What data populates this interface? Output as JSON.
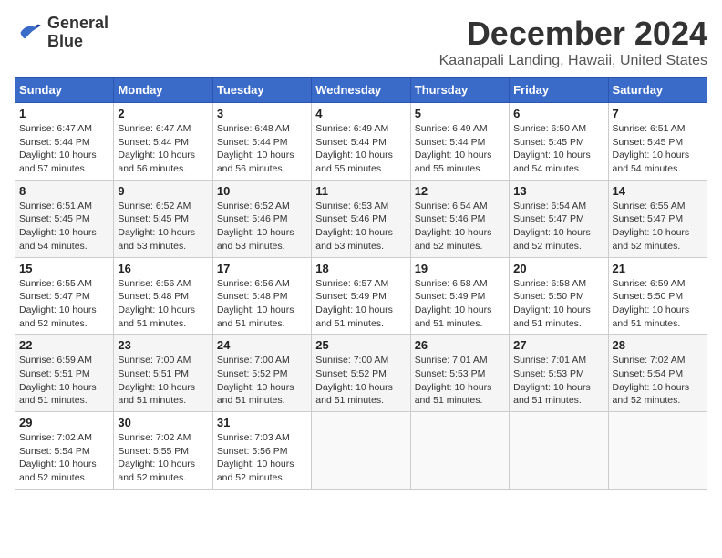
{
  "header": {
    "logo_line1": "General",
    "logo_line2": "Blue",
    "month": "December 2024",
    "location": "Kaanapali Landing, Hawaii, United States"
  },
  "weekdays": [
    "Sunday",
    "Monday",
    "Tuesday",
    "Wednesday",
    "Thursday",
    "Friday",
    "Saturday"
  ],
  "weeks": [
    [
      {
        "day": "1",
        "sunrise": "6:47 AM",
        "sunset": "5:44 PM",
        "daylight": "10 hours and 57 minutes."
      },
      {
        "day": "2",
        "sunrise": "6:47 AM",
        "sunset": "5:44 PM",
        "daylight": "10 hours and 56 minutes."
      },
      {
        "day": "3",
        "sunrise": "6:48 AM",
        "sunset": "5:44 PM",
        "daylight": "10 hours and 56 minutes."
      },
      {
        "day": "4",
        "sunrise": "6:49 AM",
        "sunset": "5:44 PM",
        "daylight": "10 hours and 55 minutes."
      },
      {
        "day": "5",
        "sunrise": "6:49 AM",
        "sunset": "5:44 PM",
        "daylight": "10 hours and 55 minutes."
      },
      {
        "day": "6",
        "sunrise": "6:50 AM",
        "sunset": "5:45 PM",
        "daylight": "10 hours and 54 minutes."
      },
      {
        "day": "7",
        "sunrise": "6:51 AM",
        "sunset": "5:45 PM",
        "daylight": "10 hours and 54 minutes."
      }
    ],
    [
      {
        "day": "8",
        "sunrise": "6:51 AM",
        "sunset": "5:45 PM",
        "daylight": "10 hours and 54 minutes."
      },
      {
        "day": "9",
        "sunrise": "6:52 AM",
        "sunset": "5:45 PM",
        "daylight": "10 hours and 53 minutes."
      },
      {
        "day": "10",
        "sunrise": "6:52 AM",
        "sunset": "5:46 PM",
        "daylight": "10 hours and 53 minutes."
      },
      {
        "day": "11",
        "sunrise": "6:53 AM",
        "sunset": "5:46 PM",
        "daylight": "10 hours and 53 minutes."
      },
      {
        "day": "12",
        "sunrise": "6:54 AM",
        "sunset": "5:46 PM",
        "daylight": "10 hours and 52 minutes."
      },
      {
        "day": "13",
        "sunrise": "6:54 AM",
        "sunset": "5:47 PM",
        "daylight": "10 hours and 52 minutes."
      },
      {
        "day": "14",
        "sunrise": "6:55 AM",
        "sunset": "5:47 PM",
        "daylight": "10 hours and 52 minutes."
      }
    ],
    [
      {
        "day": "15",
        "sunrise": "6:55 AM",
        "sunset": "5:47 PM",
        "daylight": "10 hours and 52 minutes."
      },
      {
        "day": "16",
        "sunrise": "6:56 AM",
        "sunset": "5:48 PM",
        "daylight": "10 hours and 51 minutes."
      },
      {
        "day": "17",
        "sunrise": "6:56 AM",
        "sunset": "5:48 PM",
        "daylight": "10 hours and 51 minutes."
      },
      {
        "day": "18",
        "sunrise": "6:57 AM",
        "sunset": "5:49 PM",
        "daylight": "10 hours and 51 minutes."
      },
      {
        "day": "19",
        "sunrise": "6:58 AM",
        "sunset": "5:49 PM",
        "daylight": "10 hours and 51 minutes."
      },
      {
        "day": "20",
        "sunrise": "6:58 AM",
        "sunset": "5:50 PM",
        "daylight": "10 hours and 51 minutes."
      },
      {
        "day": "21",
        "sunrise": "6:59 AM",
        "sunset": "5:50 PM",
        "daylight": "10 hours and 51 minutes."
      }
    ],
    [
      {
        "day": "22",
        "sunrise": "6:59 AM",
        "sunset": "5:51 PM",
        "daylight": "10 hours and 51 minutes."
      },
      {
        "day": "23",
        "sunrise": "7:00 AM",
        "sunset": "5:51 PM",
        "daylight": "10 hours and 51 minutes."
      },
      {
        "day": "24",
        "sunrise": "7:00 AM",
        "sunset": "5:52 PM",
        "daylight": "10 hours and 51 minutes."
      },
      {
        "day": "25",
        "sunrise": "7:00 AM",
        "sunset": "5:52 PM",
        "daylight": "10 hours and 51 minutes."
      },
      {
        "day": "26",
        "sunrise": "7:01 AM",
        "sunset": "5:53 PM",
        "daylight": "10 hours and 51 minutes."
      },
      {
        "day": "27",
        "sunrise": "7:01 AM",
        "sunset": "5:53 PM",
        "daylight": "10 hours and 51 minutes."
      },
      {
        "day": "28",
        "sunrise": "7:02 AM",
        "sunset": "5:54 PM",
        "daylight": "10 hours and 52 minutes."
      }
    ],
    [
      {
        "day": "29",
        "sunrise": "7:02 AM",
        "sunset": "5:54 PM",
        "daylight": "10 hours and 52 minutes."
      },
      {
        "day": "30",
        "sunrise": "7:02 AM",
        "sunset": "5:55 PM",
        "daylight": "10 hours and 52 minutes."
      },
      {
        "day": "31",
        "sunrise": "7:03 AM",
        "sunset": "5:56 PM",
        "daylight": "10 hours and 52 minutes."
      },
      null,
      null,
      null,
      null
    ]
  ]
}
